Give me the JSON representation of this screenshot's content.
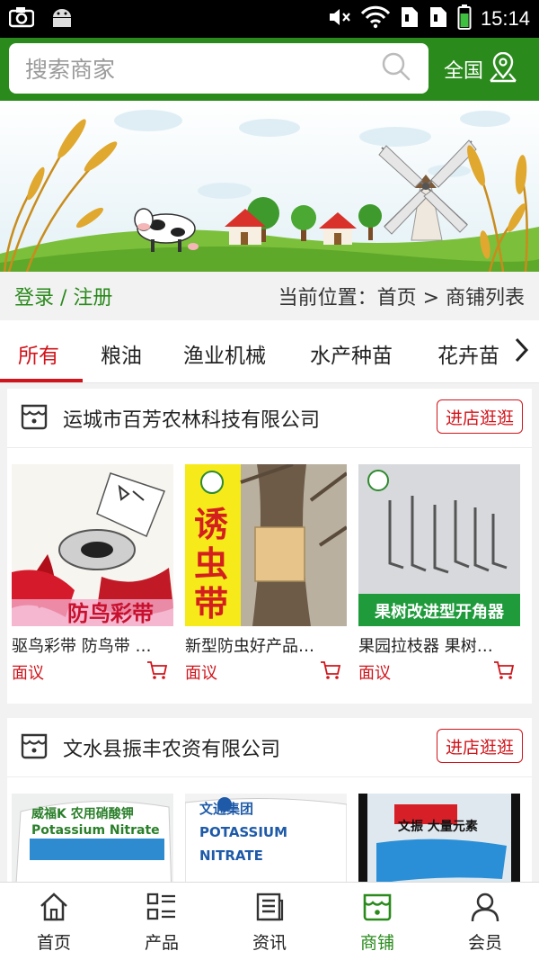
{
  "status_bar": {
    "time": "15:14",
    "icons": [
      "camera-icon",
      "android-icon",
      "mute-icon",
      "wifi-icon",
      "sim-card-icon",
      "sim-card-icon",
      "battery-icon"
    ]
  },
  "header": {
    "search_placeholder": "搜索商家",
    "region_label": "全国"
  },
  "location_bar": {
    "login_label": "登录 / 注册",
    "breadcrumb": "当前位置：首页 > 商铺列表"
  },
  "tabs": [
    {
      "label": "所有",
      "active": true
    },
    {
      "label": "粮油",
      "active": false
    },
    {
      "label": "渔业机械",
      "active": false
    },
    {
      "label": "水产种苗",
      "active": false
    },
    {
      "label": "花卉苗",
      "active": false
    }
  ],
  "shops": [
    {
      "name": "运城市百芳农林科技有限公司",
      "enter_label": "进店逛逛",
      "products": [
        {
          "name": "驱鸟彩带 防鸟带 …",
          "price": "面议",
          "image_text": "防鸟彩带"
        },
        {
          "name": "新型防虫好产品…",
          "price": "面议",
          "image_text": "诱虫带"
        },
        {
          "name": "果园拉枝器 果树…",
          "price": "面议",
          "image_text": "果树改进型开角器"
        }
      ]
    },
    {
      "name": "文水县振丰农资有限公司",
      "enter_label": "进店逛逛",
      "products": [
        {
          "name": "",
          "price": "",
          "image_text": "威福K 农用硝酸钾 Potassium Nitrate"
        },
        {
          "name": "",
          "price": "",
          "image_text": "文通集团 POTASSIUM NITRATE"
        },
        {
          "name": "",
          "price": "",
          "image_text": "文振 大量元素"
        }
      ]
    }
  ],
  "bottom_nav": [
    {
      "label": "首页",
      "icon": "home-icon",
      "active": false
    },
    {
      "label": "产品",
      "icon": "grid-list-icon",
      "active": false
    },
    {
      "label": "资讯",
      "icon": "news-icon",
      "active": false
    },
    {
      "label": "商铺",
      "icon": "shop-icon",
      "active": true
    },
    {
      "label": "会员",
      "icon": "user-icon",
      "active": false
    }
  ],
  "colors": {
    "brand_green": "#2a8a1c",
    "accent_red": "#d0141b"
  }
}
